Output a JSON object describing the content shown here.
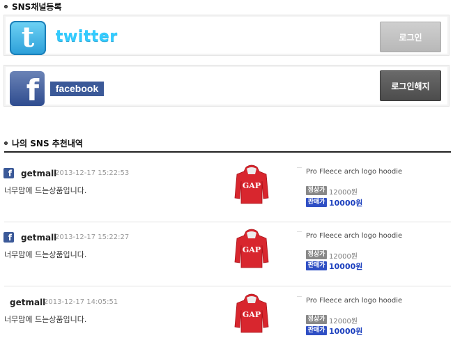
{
  "sns_register": {
    "title": "SNS채널등록",
    "twitter": {
      "wordmark": "twitter",
      "button_label": "로그인"
    },
    "facebook": {
      "wordmark": "facebook",
      "button_label": "로그인해지"
    }
  },
  "recommend": {
    "title": "나의 SNS 추천내역",
    "items": [
      {
        "has_facebook_icon": true,
        "user": "getmall",
        "time": "2013-12-17 15:22:53",
        "comment": "너무맘에 드는상품입니다.",
        "product_name": "Pro Fleece arch logo hoodie",
        "normal_label": "정상가",
        "normal_price": "12000원",
        "sale_label": "판매가",
        "sale_price": "10000원"
      },
      {
        "has_facebook_icon": true,
        "user": "getmall",
        "time": "2013-12-17 15:22:27",
        "comment": "너무맘에 드는상품입니다.",
        "product_name": "Pro Fleece arch logo hoodie",
        "normal_label": "정상가",
        "normal_price": "12000원",
        "sale_label": "판매가",
        "sale_price": "10000원"
      },
      {
        "has_facebook_icon": false,
        "user": "getmall",
        "time": "2013-12-17 14:05:51",
        "comment": "너무맘에 드는상품입니다.",
        "product_name": "Pro Fleece arch logo hoodie",
        "normal_label": "정상가",
        "normal_price": "12000원",
        "sale_label": "판매가",
        "sale_price": "10000원"
      }
    ]
  },
  "colors": {
    "twitter": "#33ccff",
    "facebook": "#3b5998",
    "sale": "#1b3fbe",
    "hoodie": "#d8262e"
  }
}
